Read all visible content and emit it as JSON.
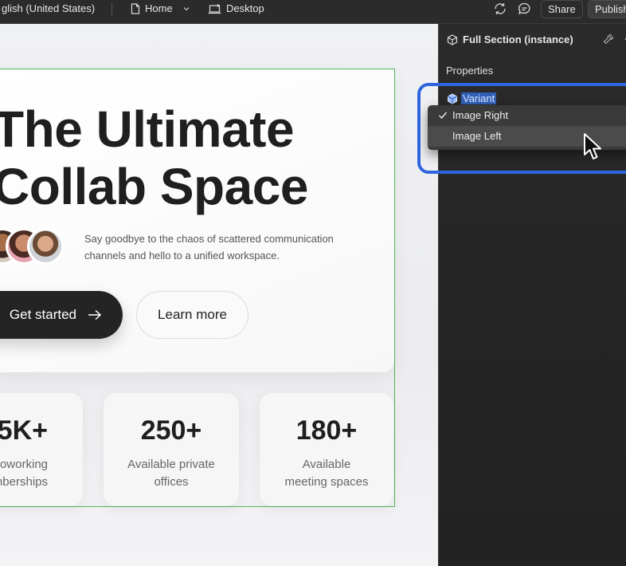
{
  "topbar": {
    "language": "glish (United States)",
    "page": "Home",
    "breakpoint": "Desktop",
    "share_label": "Share",
    "publish_label": "Publish"
  },
  "canvas": {
    "headline_line1": "The Ultimate",
    "headline_line2": "Collab Space",
    "subtitle": "Say goodbye to the chaos of scattered communication channels and hello to a unified workspace.",
    "cta_primary": "Get started",
    "cta_secondary": "Learn more",
    "stats": [
      {
        "value": "5K+",
        "label_line1": "oworking",
        "label_line2": "mberships"
      },
      {
        "value": "250+",
        "label_line1": "Available private",
        "label_line2": "offices"
      },
      {
        "value": "180+",
        "label_line1": "Available",
        "label_line2": "meeting spaces"
      }
    ]
  },
  "panel": {
    "title": "Full Section (instance)",
    "properties_label": "Properties",
    "variant_label": "Variant",
    "dropdown": {
      "selected": "Image Right",
      "options": [
        "Image Right",
        "Image Left"
      ],
      "hovered": "Image Left"
    }
  },
  "colors": {
    "selection_frame": "#4fb563",
    "highlight_outline": "#2f66e0",
    "primary_button": "#242424"
  }
}
